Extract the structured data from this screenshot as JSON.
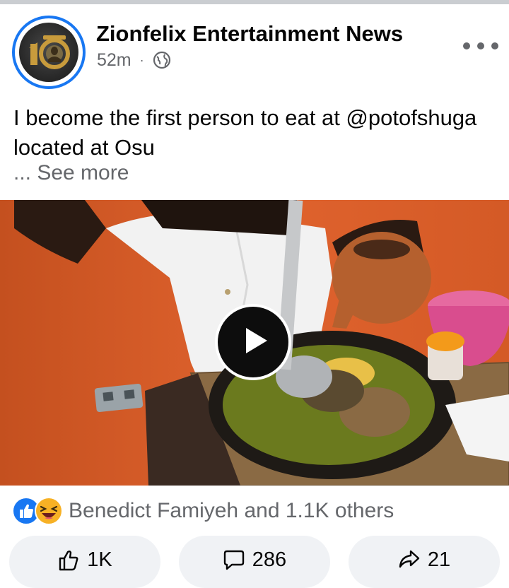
{
  "post": {
    "page_name": "Zionfelix Entertainment News",
    "time_ago": "52m",
    "separator": "·",
    "text": "I become the first person to eat at @potofshuga located at Osu",
    "see_more": "... See more"
  },
  "video": {
    "state": "paused"
  },
  "engagement": {
    "reactions_text": "Benedict Famiyeh and 1.1K others",
    "reaction_icons": [
      "like-icon",
      "laugh-icon"
    ],
    "like_count": "1K",
    "comment_count": "286",
    "share_count": "21"
  },
  "colors": {
    "accent": "#1877f2",
    "secondary_text": "#65676b",
    "button_bg": "#f0f2f5",
    "laugh_yellow": "#f7b125"
  }
}
